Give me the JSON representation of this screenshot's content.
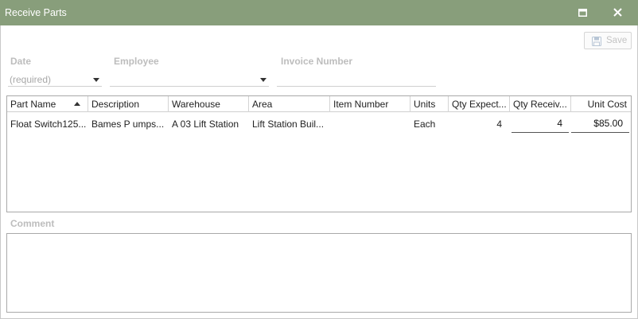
{
  "window": {
    "title": "Receive Parts"
  },
  "toolbar": {
    "save_label": "Save"
  },
  "form": {
    "date": {
      "label": "Date",
      "value": "(required)"
    },
    "employee": {
      "label": "Employee",
      "value": ""
    },
    "invoice": {
      "label": "Invoice Number",
      "value": ""
    }
  },
  "grid": {
    "columns": [
      "Part Name",
      "Description",
      "Warehouse",
      "Area",
      "Item Number",
      "Units",
      "Qty Expect...",
      "Qty Receiv...",
      "Unit Cost"
    ],
    "sorted_column": "Part Name",
    "sort_direction": "ascending",
    "rows": [
      {
        "part_name": "Float Switch125...",
        "description": "Bames P umps...",
        "warehouse": "A 03 Lift Station",
        "area": "Lift Station Buil...",
        "item_number": "",
        "units": "Each",
        "qty_expected": "4",
        "qty_received": "4",
        "unit_cost": "$85.00"
      }
    ]
  },
  "comment": {
    "label": "Comment",
    "value": ""
  },
  "colors": {
    "titlebar": "#889e7b",
    "disabled_text": "#bdbdbd"
  },
  "icons": {
    "maximize": "maximize-icon",
    "close": "close-icon",
    "save": "floppy-disk-icon"
  }
}
